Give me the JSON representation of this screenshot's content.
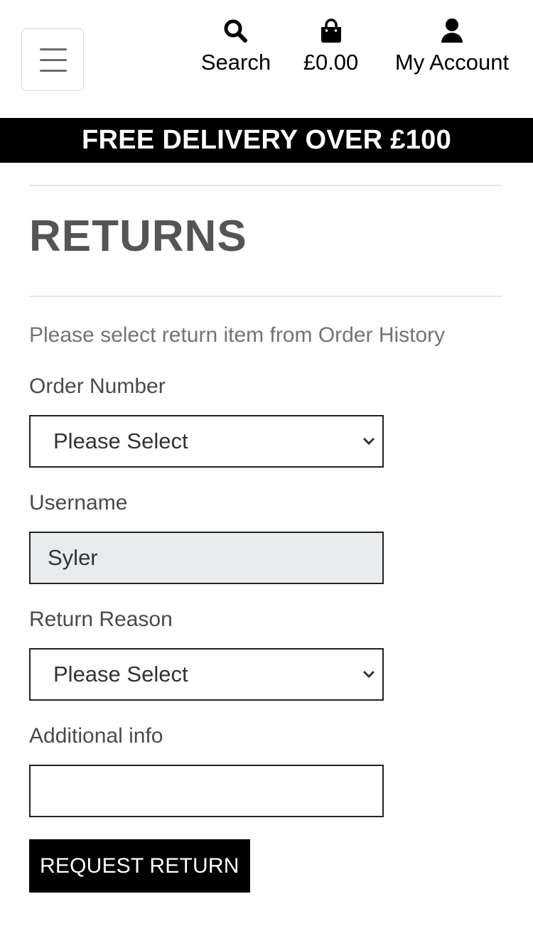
{
  "header": {
    "menu_icon": "hamburger-icon",
    "search": {
      "icon": "search-icon",
      "label": "Search"
    },
    "bag": {
      "icon": "shopping-bag-icon",
      "label": "£0.00"
    },
    "account": {
      "icon": "user-icon",
      "label": "My Account"
    }
  },
  "banner": {
    "text": "FREE DELIVERY OVER £100"
  },
  "page": {
    "title": "RETURNS",
    "intro": "Please select return item from Order History"
  },
  "form": {
    "order_number": {
      "label": "Order Number",
      "value": "Please Select"
    },
    "username": {
      "label": "Username",
      "value": "Syler"
    },
    "return_reason": {
      "label": "Return Reason",
      "value": "Please Select"
    },
    "additional_info": {
      "label": "Additional info",
      "value": ""
    },
    "submit_label": "REQUEST RETURN"
  },
  "colors": {
    "banner_bg": "#000000",
    "title": "#555555",
    "muted_text": "#6c757d",
    "readonly_bg": "#e9ecef"
  }
}
